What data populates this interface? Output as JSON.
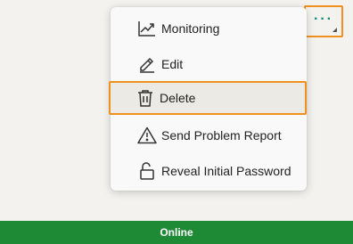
{
  "more_button": {
    "icon": "more-horizontal-icon",
    "accent": "#0e8a7a",
    "glyph": "···"
  },
  "menu": {
    "items": [
      {
        "label": "Monitoring",
        "icon": "chart-line-icon",
        "selected": false
      },
      {
        "label": "Edit",
        "icon": "pencil-icon",
        "selected": false
      },
      {
        "label": "Delete",
        "icon": "trash-icon",
        "selected": true
      },
      {
        "label": "Send Problem Report",
        "icon": "warning-icon",
        "selected": false
      },
      {
        "label": "Reveal Initial Password",
        "icon": "unlock-icon",
        "selected": false
      }
    ]
  },
  "status": {
    "text": "Online",
    "color": "#1f8a36"
  },
  "colors": {
    "highlight": "#f0901e",
    "background": "#f3f2ee"
  }
}
